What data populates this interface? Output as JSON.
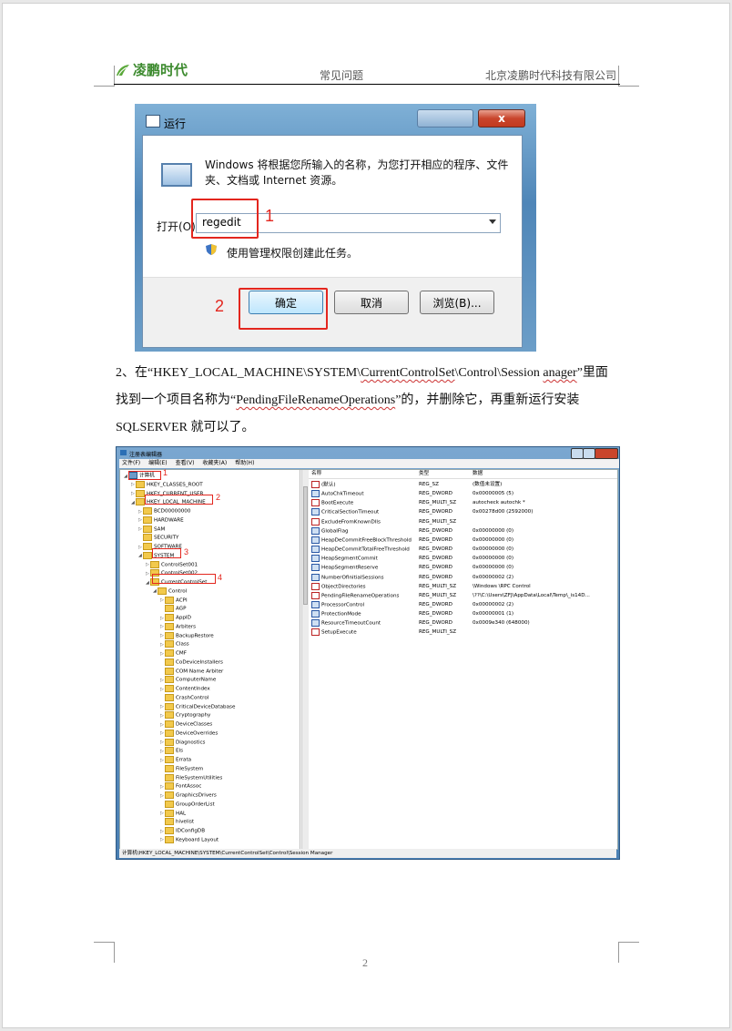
{
  "header": {
    "logo_text": "凌鹏时代",
    "center": "常见问题",
    "right": "北京凌鹏时代科技有限公司"
  },
  "run_dialog": {
    "title": "运行",
    "description": "Windows 将根据您所输入的名称，为您打开相应的程序、文件夹、文档或 Internet 资源。",
    "open_label": "打开(O):",
    "input_value": "regedit",
    "admin_note": "使用管理权限创建此任务。",
    "ok_label": "确定",
    "cancel_label": "取消",
    "browse_label": "浏览(B)...",
    "close_glyph": "x",
    "marker_1": "1",
    "marker_2": "2"
  },
  "instruction": {
    "line1_a": "2、在“HKEY_LOCAL_MACHINE\\SYSTEM\\",
    "line1_b": "CurrentControlSet",
    "line1_c": "\\Control\\Session ",
    "line1_d": "anager",
    "line1_e": "”里面",
    "line2_a": "找到一个项目名称为“",
    "line2_b": "PendingFileRenameOperations",
    "line2_c": "”的，并删除它，再重新运行安装",
    "line3": "SQLSERVER 就可以了。"
  },
  "registry": {
    "title": "注册表编辑器",
    "menu": [
      "文件(F)",
      "编辑(E)",
      "查看(V)",
      "收藏夹(A)",
      "帮助(H)"
    ],
    "tree": [
      {
        "label": "计算机",
        "exp": "◢",
        "indent": 0,
        "folder": false
      },
      {
        "label": "HKEY_CLASSES_ROOT",
        "exp": "▷",
        "indent": 1,
        "folder": true
      },
      {
        "label": "HKEY_CURRENT_USER",
        "exp": "▷",
        "indent": 1,
        "folder": true
      },
      {
        "label": "HKEY_LOCAL_MACHINE",
        "exp": "◢",
        "indent": 1,
        "folder": true
      },
      {
        "label": "BCD00000000",
        "exp": "▷",
        "indent": 2,
        "folder": true
      },
      {
        "label": "HARDWARE",
        "exp": "▷",
        "indent": 2,
        "folder": true
      },
      {
        "label": "SAM",
        "exp": "▷",
        "indent": 2,
        "folder": true
      },
      {
        "label": "SECURITY",
        "exp": "",
        "indent": 2,
        "folder": true
      },
      {
        "label": "SOFTWARE",
        "exp": "▷",
        "indent": 2,
        "folder": true
      },
      {
        "label": "SYSTEM",
        "exp": "◢",
        "indent": 2,
        "folder": true
      },
      {
        "label": "ControlSet001",
        "exp": "▷",
        "indent": 3,
        "folder": true
      },
      {
        "label": "ControlSet002",
        "exp": "▷",
        "indent": 3,
        "folder": true
      },
      {
        "label": "CurrentControlSet",
        "exp": "◢",
        "indent": 3,
        "folder": true
      },
      {
        "label": "Control",
        "exp": "◢",
        "indent": 4,
        "folder": true
      },
      {
        "label": "ACPI",
        "exp": "▷",
        "indent": 5,
        "folder": true
      },
      {
        "label": "AGP",
        "exp": "",
        "indent": 5,
        "folder": true
      },
      {
        "label": "AppID",
        "exp": "▷",
        "indent": 5,
        "folder": true
      },
      {
        "label": "Arbiters",
        "exp": "▷",
        "indent": 5,
        "folder": true
      },
      {
        "label": "BackupRestore",
        "exp": "▷",
        "indent": 5,
        "folder": true
      },
      {
        "label": "Class",
        "exp": "▷",
        "indent": 5,
        "folder": true
      },
      {
        "label": "CMF",
        "exp": "▷",
        "indent": 5,
        "folder": true
      },
      {
        "label": "CoDeviceInstallers",
        "exp": "",
        "indent": 5,
        "folder": true
      },
      {
        "label": "COM Name Arbiter",
        "exp": "",
        "indent": 5,
        "folder": true
      },
      {
        "label": "ComputerName",
        "exp": "▷",
        "indent": 5,
        "folder": true
      },
      {
        "label": "ContentIndex",
        "exp": "▷",
        "indent": 5,
        "folder": true
      },
      {
        "label": "CrashControl",
        "exp": "",
        "indent": 5,
        "folder": true
      },
      {
        "label": "CriticalDeviceDatabase",
        "exp": "▷",
        "indent": 5,
        "folder": true
      },
      {
        "label": "Cryptography",
        "exp": "▷",
        "indent": 5,
        "folder": true
      },
      {
        "label": "DeviceClasses",
        "exp": "▷",
        "indent": 5,
        "folder": true
      },
      {
        "label": "DeviceOverrides",
        "exp": "▷",
        "indent": 5,
        "folder": true
      },
      {
        "label": "Diagnostics",
        "exp": "▷",
        "indent": 5,
        "folder": true
      },
      {
        "label": "Els",
        "exp": "▷",
        "indent": 5,
        "folder": true
      },
      {
        "label": "Errata",
        "exp": "▷",
        "indent": 5,
        "folder": true
      },
      {
        "label": "FileSystem",
        "exp": "",
        "indent": 5,
        "folder": true
      },
      {
        "label": "FileSystemUtilities",
        "exp": "",
        "indent": 5,
        "folder": true
      },
      {
        "label": "FontAssoc",
        "exp": "▷",
        "indent": 5,
        "folder": true
      },
      {
        "label": "GraphicsDrivers",
        "exp": "▷",
        "indent": 5,
        "folder": true
      },
      {
        "label": "GroupOrderList",
        "exp": "",
        "indent": 5,
        "folder": true
      },
      {
        "label": "HAL",
        "exp": "▷",
        "indent": 5,
        "folder": true
      },
      {
        "label": "hivelist",
        "exp": "",
        "indent": 5,
        "folder": true
      },
      {
        "label": "IDConfigDB",
        "exp": "▷",
        "indent": 5,
        "folder": true
      },
      {
        "label": "Keyboard Layout",
        "exp": "▷",
        "indent": 5,
        "folder": true
      }
    ],
    "columns": {
      "name": "名称",
      "type": "类型",
      "data": "数据"
    },
    "values": [
      {
        "name": "(默认)",
        "type": "REG_SZ",
        "data": "(数值未设置)",
        "kind": "sz"
      },
      {
        "name": "AutoChkTimeout",
        "type": "REG_DWORD",
        "data": "0x00000005 (5)",
        "kind": "dw"
      },
      {
        "name": "BootExecute",
        "type": "REG_MULTI_SZ",
        "data": "autocheck autochk *",
        "kind": "sz"
      },
      {
        "name": "CriticalSectionTimeout",
        "type": "REG_DWORD",
        "data": "0x00278d00 (2592000)",
        "kind": "dw"
      },
      {
        "name": "ExcludeFromKnownDlls",
        "type": "REG_MULTI_SZ",
        "data": "",
        "kind": "sz"
      },
      {
        "name": "GlobalFlag",
        "type": "REG_DWORD",
        "data": "0x00000000 (0)",
        "kind": "dw"
      },
      {
        "name": "HeapDeCommitFreeBlockThreshold",
        "type": "REG_DWORD",
        "data": "0x00000000 (0)",
        "kind": "dw"
      },
      {
        "name": "HeapDeCommitTotalFreeThreshold",
        "type": "REG_DWORD",
        "data": "0x00000000 (0)",
        "kind": "dw"
      },
      {
        "name": "HeapSegmentCommit",
        "type": "REG_DWORD",
        "data": "0x00000000 (0)",
        "kind": "dw"
      },
      {
        "name": "HeapSegmentReserve",
        "type": "REG_DWORD",
        "data": "0x00000000 (0)",
        "kind": "dw"
      },
      {
        "name": "NumberOfInitialSessions",
        "type": "REG_DWORD",
        "data": "0x00000002 (2)",
        "kind": "dw"
      },
      {
        "name": "ObjectDirectories",
        "type": "REG_MULTI_SZ",
        "data": "\\Windows \\RPC Control",
        "kind": "sz"
      },
      {
        "name": "PendingFileRenameOperations",
        "type": "REG_MULTI_SZ",
        "data": "\\??\\C:\\Users\\ZFJ\\AppData\\Local\\Temp\\_is14D...",
        "kind": "sz"
      },
      {
        "name": "ProcessorControl",
        "type": "REG_DWORD",
        "data": "0x00000002 (2)",
        "kind": "dw"
      },
      {
        "name": "ProtectionMode",
        "type": "REG_DWORD",
        "data": "0x00000001 (1)",
        "kind": "dw"
      },
      {
        "name": "ResourceTimeoutCount",
        "type": "REG_DWORD",
        "data": "0x0009e340 (648000)",
        "kind": "dw"
      },
      {
        "name": "SetupExecute",
        "type": "REG_MULTI_SZ",
        "data": "",
        "kind": "sz"
      }
    ],
    "status": "计算机\\HKEY_LOCAL_MACHINE\\SYSTEM\\CurrentControlSet\\Control\\Session Manager",
    "markers": [
      "1",
      "2",
      "3",
      "4"
    ]
  },
  "footer": {
    "page_number": "2"
  }
}
